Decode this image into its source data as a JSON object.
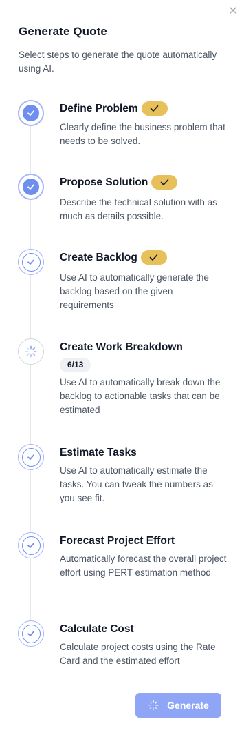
{
  "panel": {
    "title": "Generate Quote",
    "subtitle": "Select steps to generate the quote automatically using AI."
  },
  "steps": [
    {
      "title": "Define Problem",
      "description": "Clearly define the business problem that needs to be solved.",
      "status": "completed"
    },
    {
      "title": "Propose Solution",
      "description": "Describe the technical solution with as much as details possible.",
      "status": "completed"
    },
    {
      "title": "Create Backlog",
      "description": "Use AI to automatically generate the backlog based on the given requirements",
      "status": "completed"
    },
    {
      "title": "Create Work Breakdown",
      "progress": "6/13",
      "description": "Use AI to automatically break down the backlog to actionable tasks that can be estimated",
      "status": "in-progress"
    },
    {
      "title": "Estimate Tasks",
      "description": "Use AI to automatically estimate the tasks. You can tweak the numbers as you see fit.",
      "status": "selected"
    },
    {
      "title": "Forecast Project Effort",
      "description": "Automatically forecast the overall project effort using PERT estimation method",
      "status": "selected"
    },
    {
      "title": "Calculate Cost",
      "description": "Calculate project costs using the Rate Card and the estimated effort",
      "status": "selected"
    }
  ],
  "actions": {
    "generate_label": "Generate"
  },
  "icons": {
    "close": "close-icon",
    "check": "check-icon",
    "spinner": "spinner-icon"
  },
  "colors": {
    "accent": "#6f8ff0",
    "accent_light": "#a5b4fc",
    "badge_yellow": "#e8c05a",
    "button": "#8ea6f5"
  }
}
